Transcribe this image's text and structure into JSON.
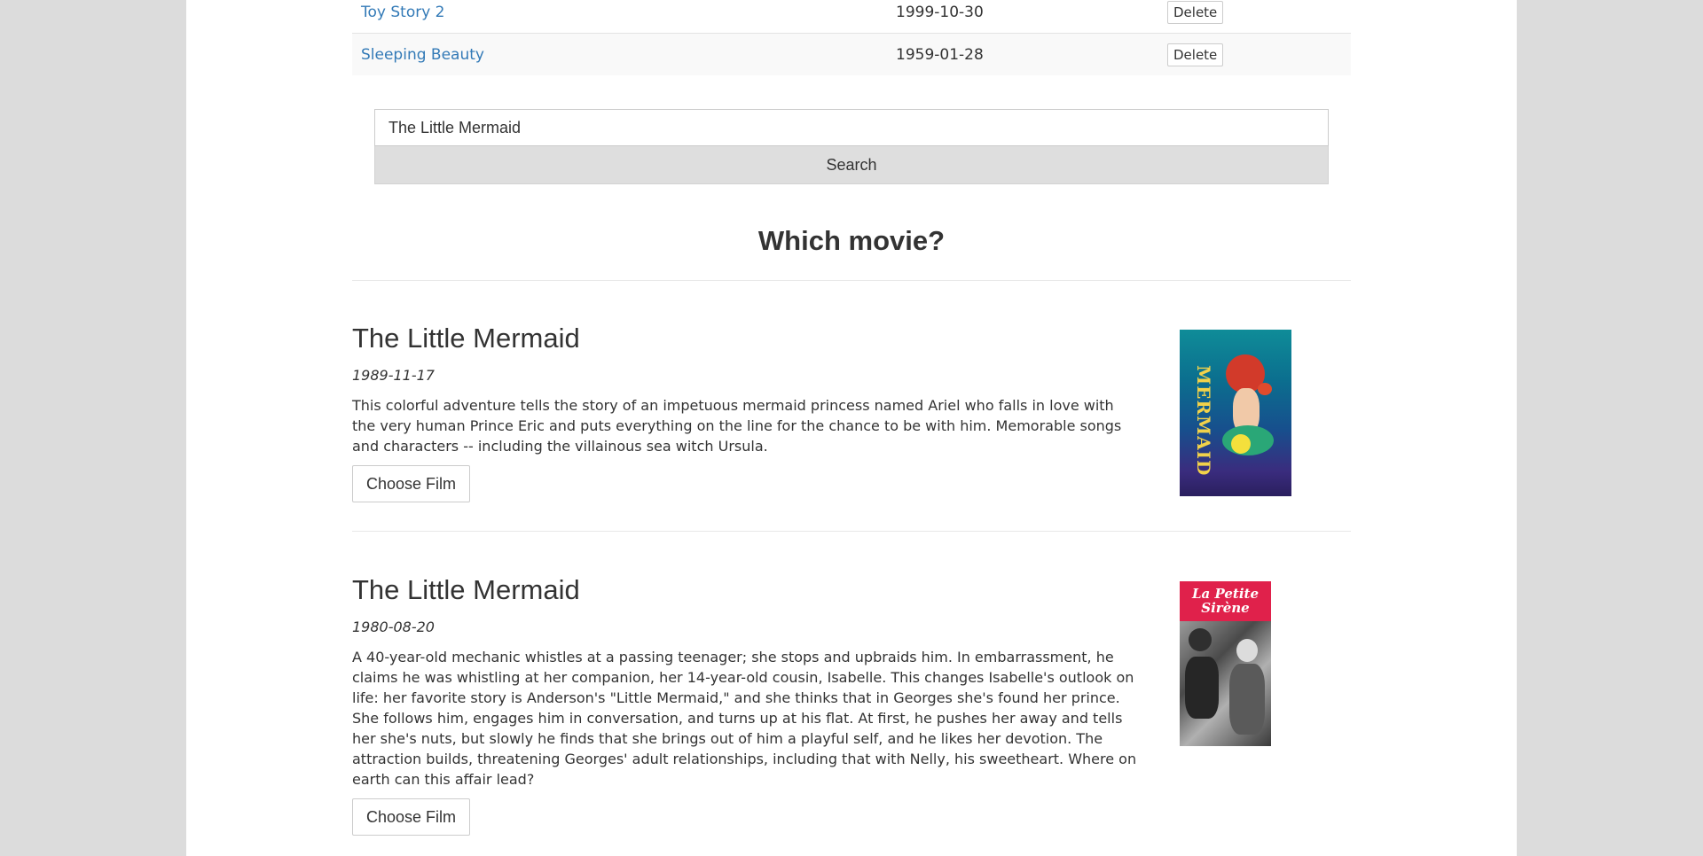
{
  "favorites": [
    {
      "title": "Toy Story 2",
      "date": "1999-10-30",
      "delete_label": "Delete"
    },
    {
      "title": "Sleeping Beauty",
      "date": "1959-01-28",
      "delete_label": "Delete"
    }
  ],
  "search": {
    "value": "The Little Mermaid",
    "button_label": "Search"
  },
  "results_heading": "Which movie?",
  "results": [
    {
      "title": "The Little Mermaid",
      "date": "1989-11-17",
      "description": "This colorful adventure tells the story of an impetuous mermaid princess named Ariel who falls in love with the very human Prince Eric and puts everything on the line for the chance to be with him. Memorable songs and characters -- including the villainous sea witch Ursula.",
      "choose_label": "Choose Film",
      "poster_text": "MERMAID"
    },
    {
      "title": "The Little Mermaid",
      "date": "1980-08-20",
      "description": "A 40-year-old mechanic whistles at a passing teenager; she stops and upbraids him. In embarrassment, he claims he was whistling at her companion, her 14-year-old cousin, Isabelle. This changes Isabelle's outlook on life: her favorite story is Anderson's \"Little Mermaid,\" and she thinks that in Georges she's found her prince. She follows him, engages him in conversation, and turns up at his flat. At first, he pushes her away and tells her she's nuts, but slowly he finds that she brings out of him a playful self, and he likes her devotion. The attraction builds, threatening Georges' adult relationships, including that with Nelly, his sweetheart. Where on earth can this affair lead?",
      "choose_label": "Choose Film",
      "poster_text_1": "La Petite",
      "poster_text_2": "Sirène"
    }
  ],
  "colors": {
    "link": "#337ab7",
    "page_background": "#dcdcdc",
    "search_button": "#dedede"
  }
}
